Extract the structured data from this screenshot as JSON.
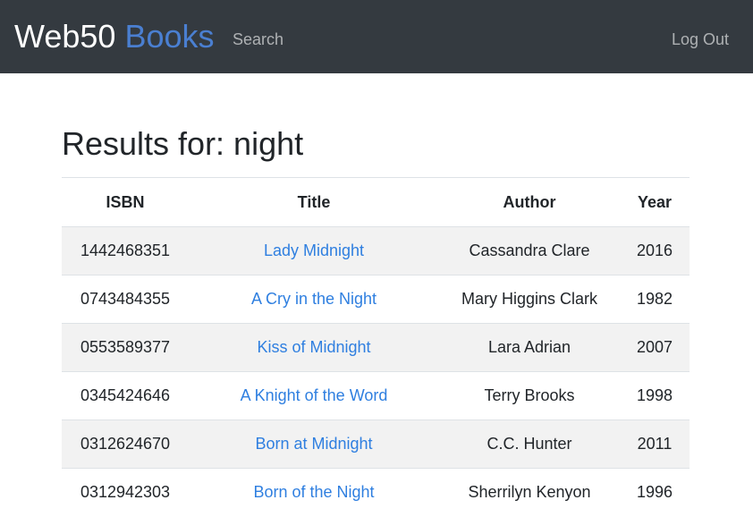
{
  "navbar": {
    "brand_primary": "Web50",
    "brand_accent": "Books",
    "search_link": "Search",
    "logout_link": "Log Out",
    "background": "#343a40",
    "accent_color": "#4a7fd1"
  },
  "main": {
    "heading": "Results for: night",
    "table": {
      "headers": [
        "ISBN",
        "Title",
        "Author",
        "Year"
      ],
      "rows": [
        {
          "isbn": "1442468351",
          "title": "Lady Midnight",
          "author": "Cassandra Clare",
          "year": "2016"
        },
        {
          "isbn": "0743484355",
          "title": "A Cry in the Night",
          "author": "Mary Higgins Clark",
          "year": "1982"
        },
        {
          "isbn": "0553589377",
          "title": "Kiss of Midnight",
          "author": "Lara Adrian",
          "year": "2007"
        },
        {
          "isbn": "0345424646",
          "title": "A Knight of the Word",
          "author": "Terry Brooks",
          "year": "1998"
        },
        {
          "isbn": "0312624670",
          "title": "Born at Midnight",
          "author": "C.C. Hunter",
          "year": "2011"
        },
        {
          "isbn": "0312942303",
          "title": "Born of the Night",
          "author": "Sherrilyn Kenyon",
          "year": "1996"
        }
      ]
    },
    "link_color": "#2f7fe0",
    "stripe_color": "#f2f2f2"
  }
}
